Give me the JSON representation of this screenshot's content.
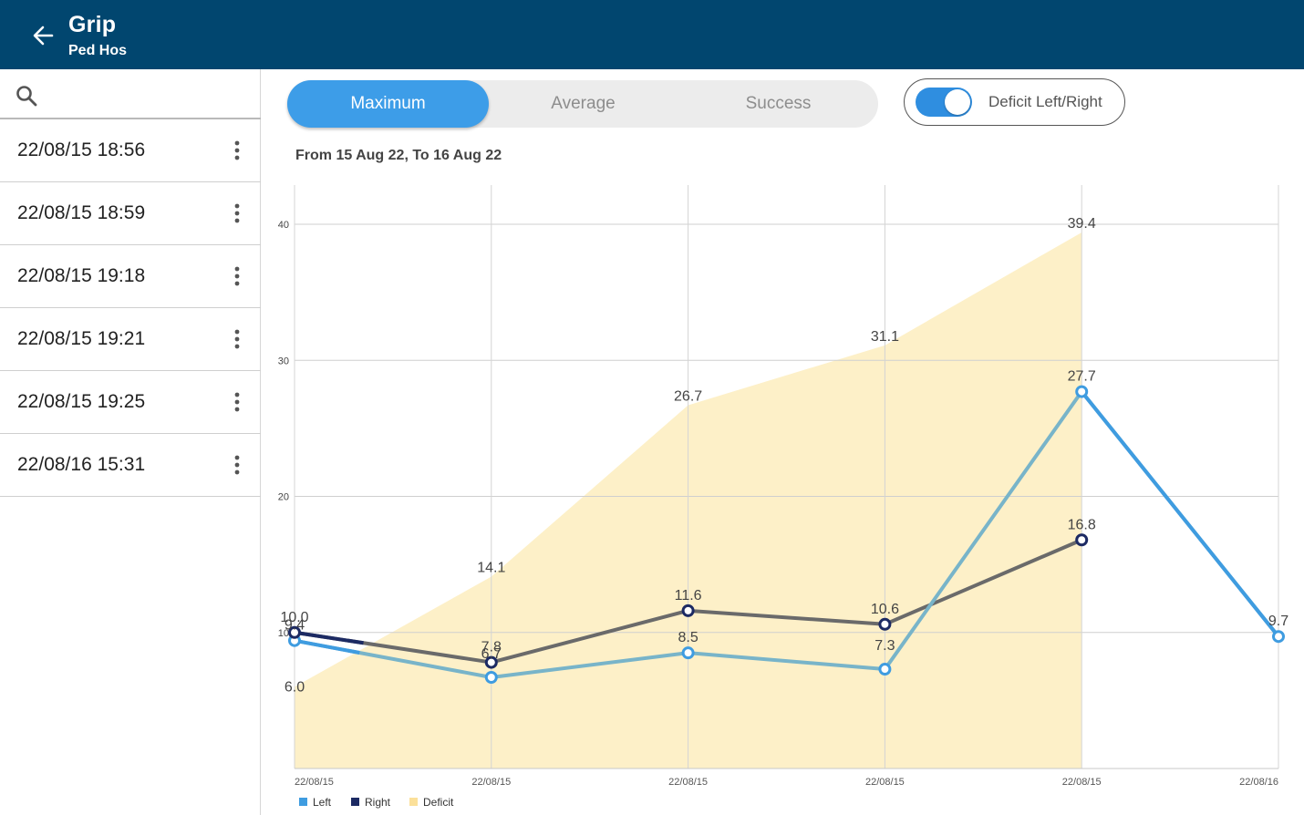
{
  "header": {
    "title": "Grip",
    "subtitle": "Ped Hos"
  },
  "search": {
    "placeholder": "",
    "value": ""
  },
  "sessions": [
    {
      "label": "22/08/15 18:56"
    },
    {
      "label": "22/08/15 18:59"
    },
    {
      "label": "22/08/15 19:18"
    },
    {
      "label": "22/08/15 19:21"
    },
    {
      "label": "22/08/15 19:25"
    },
    {
      "label": "22/08/16 15:31"
    }
  ],
  "tabs": {
    "maximum": "Maximum",
    "average": "Average",
    "success": "Success",
    "active": "maximum"
  },
  "toggle": {
    "label": "Deficit Left/Right",
    "on": true
  },
  "date_range": "From 15 Aug 22, To 16 Aug 22",
  "colors": {
    "header": "#01466f",
    "accent": "#3d9de8",
    "left": "#3f9ce0",
    "left_muted": "#78b4c9",
    "right": "#1c2a63",
    "right_muted": "#6a6a6a",
    "deficit": "#fdf0c8"
  },
  "chart_data": {
    "type": "line",
    "x": [
      "22/08/15",
      "22/08/15",
      "22/08/15",
      "22/08/15",
      "22/08/15",
      "22/08/16"
    ],
    "ylim": [
      0,
      42
    ],
    "yticks": [
      10,
      20,
      30,
      40
    ],
    "grid": true,
    "legend_position": "bottom-left",
    "series": [
      {
        "name": "Left",
        "type": "line",
        "values": [
          9.4,
          6.7,
          8.5,
          7.3,
          27.7,
          9.7
        ],
        "labels": [
          "9.4",
          "6.7",
          "8.5",
          "7.3",
          "27.7",
          "9.7"
        ]
      },
      {
        "name": "Right",
        "type": "line",
        "values": [
          10.0,
          7.8,
          11.6,
          10.6,
          16.8,
          null
        ],
        "labels": [
          "10.0",
          "7.8",
          "11.6",
          "10.6",
          "16.8",
          ""
        ]
      },
      {
        "name": "Deficit",
        "type": "area",
        "values": [
          6.0,
          14.1,
          26.7,
          31.1,
          39.4,
          null
        ],
        "labels": [
          "6.0",
          "14.1",
          "26.7",
          "31.1",
          "39.4",
          ""
        ]
      }
    ]
  }
}
